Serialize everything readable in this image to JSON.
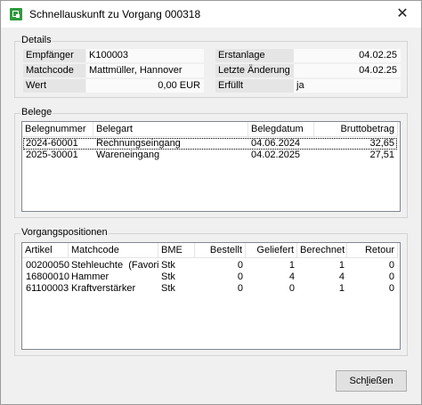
{
  "window": {
    "title": "Schnellauskunft zu Vorgang 000318",
    "close_symbol": "✕"
  },
  "details": {
    "legend": "Details",
    "empfaenger_label": "Empfänger",
    "empfaenger_value": "K100003",
    "matchcode_label": "Matchcode",
    "matchcode_value": "Mattmüller, Hannover",
    "wert_label": "Wert",
    "wert_value": "0,00 EUR",
    "erstanlage_label": "Erstanlage",
    "erstanlage_value": "04.02.25",
    "aenderung_label": "Letzte Änderung",
    "aenderung_value": "04.02.25",
    "erfuellt_label": "Erfüllt",
    "erfuellt_value": "ja"
  },
  "belege": {
    "legend": "Belege",
    "columns": [
      "Belegnummer",
      "Belegart",
      "Belegdatum",
      "Bruttobetrag"
    ],
    "rows": [
      [
        "2024-60001",
        "Rechnungseingang",
        "04.06.2024",
        "32,65"
      ],
      [
        "2025-30001",
        "Wareneingang",
        "04.02.2025",
        "27,51"
      ]
    ]
  },
  "positionen": {
    "legend": "Vorgangspositionen",
    "columns": [
      "Artikel",
      "Matchcode",
      "BME",
      "Bestellt",
      "Geliefert",
      "Berechnet",
      "Retour"
    ],
    "rows": [
      [
        "00200050",
        "Stehleuchte  (Favori",
        "Stk",
        "0",
        "1",
        "1",
        "0"
      ],
      [
        "16800010",
        "Hammer",
        "Stk",
        "0",
        "4",
        "4",
        "0"
      ],
      [
        "61100003",
        "Kraftverstärker",
        "Stk",
        "0",
        "0",
        "1",
        "0"
      ]
    ]
  },
  "buttons": {
    "close_prefix": "Sch",
    "close_accel": "l",
    "close_suffix": "ießen"
  }
}
